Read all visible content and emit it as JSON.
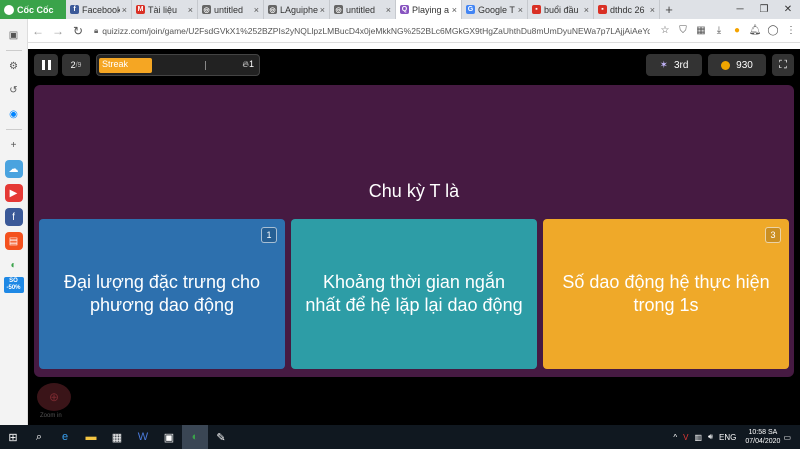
{
  "browser": {
    "brand": "Cốc Cốc",
    "tabs": [
      {
        "label": "Facebook",
        "icon": "facebook-icon",
        "color": "#3b5998",
        "glyph": "f"
      },
      {
        "label": "Tài liệu",
        "icon": "gmail-icon",
        "color": "#d93025",
        "glyph": "M"
      },
      {
        "label": "untitled",
        "icon": "globe-icon",
        "color": "#666666",
        "glyph": "◎"
      },
      {
        "label": "LAguiphe",
        "icon": "globe-icon",
        "color": "#666666",
        "glyph": "◎"
      },
      {
        "label": "untitled",
        "icon": "globe-icon",
        "color": "#666666",
        "glyph": "◎"
      },
      {
        "label": "Playing a",
        "icon": "quizizz-icon",
        "color": "#8854c0",
        "glyph": "Q",
        "active": true
      },
      {
        "label": "Google T",
        "icon": "google-translate-icon",
        "color": "#4285f4",
        "glyph": "G"
      },
      {
        "label": "buổi đầu",
        "icon": "doc-icon",
        "color": "#d93025",
        "glyph": "▪"
      },
      {
        "label": "dthdc 26",
        "icon": "doc-icon",
        "color": "#d93025",
        "glyph": "▪"
      }
    ],
    "url": "quizizz.com/join/game/U2FsdGVkX1%252BZPIs2yNQLlpzLMBucD4x0jeMkkNG%252BLc6MGkGX9tHgZaUhthDu8mUmDyuNEWa7p7LAjjAiAeYqk..."
  },
  "game": {
    "question_index": "2",
    "question_total": "/9",
    "streak_label": "Streak",
    "streak_count": "1",
    "streak_progress": 0.33,
    "rank": "3rd",
    "score": "930",
    "question": "Chu kỳ T là",
    "options": [
      {
        "num": "1",
        "text": "Đại lượng đặc trưng cho phương dao động"
      },
      {
        "num": "2",
        "text": "Khoảng thời gian ngắn nhất để hệ lặp lại dao động"
      },
      {
        "num": "3",
        "text": "Số dao động hệ thực hiện trong 1s"
      }
    ],
    "zoom_label": "Zoom in"
  },
  "taskbar": {
    "lang": "ENG",
    "time": "10:58 SA",
    "date": "07/04/2020"
  }
}
